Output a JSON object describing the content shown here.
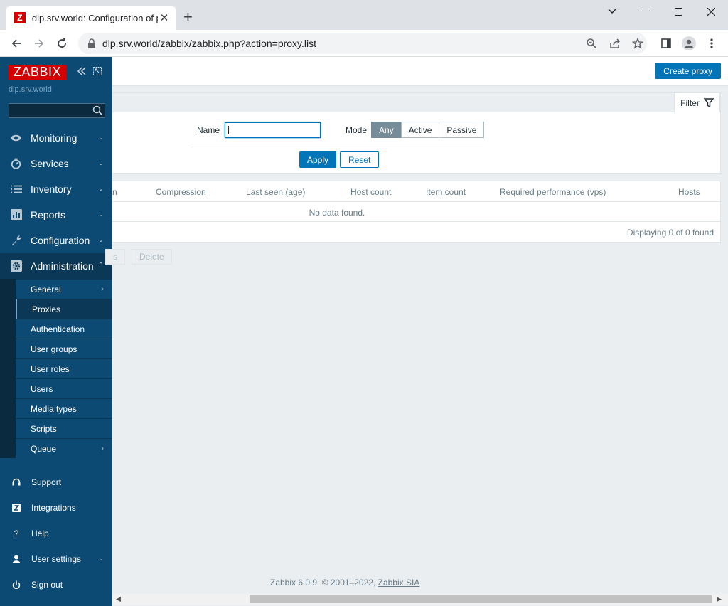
{
  "browser": {
    "tab_title": "dlp.srv.world: Configuration of pr",
    "favicon_letter": "Z",
    "url": "dlp.srv.world/zabbix/zabbix.php?action=proxy.list"
  },
  "sidebar": {
    "logo": "ZABBIX",
    "server_name": "dlp.srv.world",
    "menu": [
      {
        "label": "Monitoring",
        "icon": "eye-icon"
      },
      {
        "label": "Services",
        "icon": "stopwatch-icon"
      },
      {
        "label": "Inventory",
        "icon": "list-icon"
      },
      {
        "label": "Reports",
        "icon": "bar-chart-icon"
      },
      {
        "label": "Configuration",
        "icon": "wrench-icon"
      },
      {
        "label": "Administration",
        "icon": "gear-icon"
      }
    ],
    "admin_submenu": [
      "General",
      "Proxies",
      "Authentication",
      "User groups",
      "User roles",
      "Users",
      "Media types",
      "Scripts",
      "Queue"
    ],
    "bottom": [
      {
        "label": "Support",
        "icon": "headset-icon"
      },
      {
        "label": "Integrations",
        "icon": "integrations-icon"
      },
      {
        "label": "Help",
        "icon": "help-icon"
      },
      {
        "label": "User settings",
        "icon": "user-icon"
      },
      {
        "label": "Sign out",
        "icon": "power-icon"
      }
    ]
  },
  "header": {
    "create_button": "Create proxy"
  },
  "filter": {
    "tab_label": "Filter",
    "name_label": "Name",
    "name_value": "",
    "mode_label": "Mode",
    "mode_options": [
      "Any",
      "Active",
      "Passive"
    ],
    "mode_selected": "Any",
    "apply": "Apply",
    "reset": "Reset"
  },
  "table": {
    "columns": [
      "n",
      "Compression",
      "Last seen (age)",
      "Host count",
      "Item count",
      "Required performance (vps)",
      "Hosts"
    ],
    "empty_message": "No data found.",
    "paging": "Displaying 0 of 0 found"
  },
  "mass_actions": {
    "partial_button": "s",
    "delete": "Delete"
  },
  "footer": {
    "text": "Zabbix 6.0.9. © 2001–2022, ",
    "link": "Zabbix SIA"
  }
}
